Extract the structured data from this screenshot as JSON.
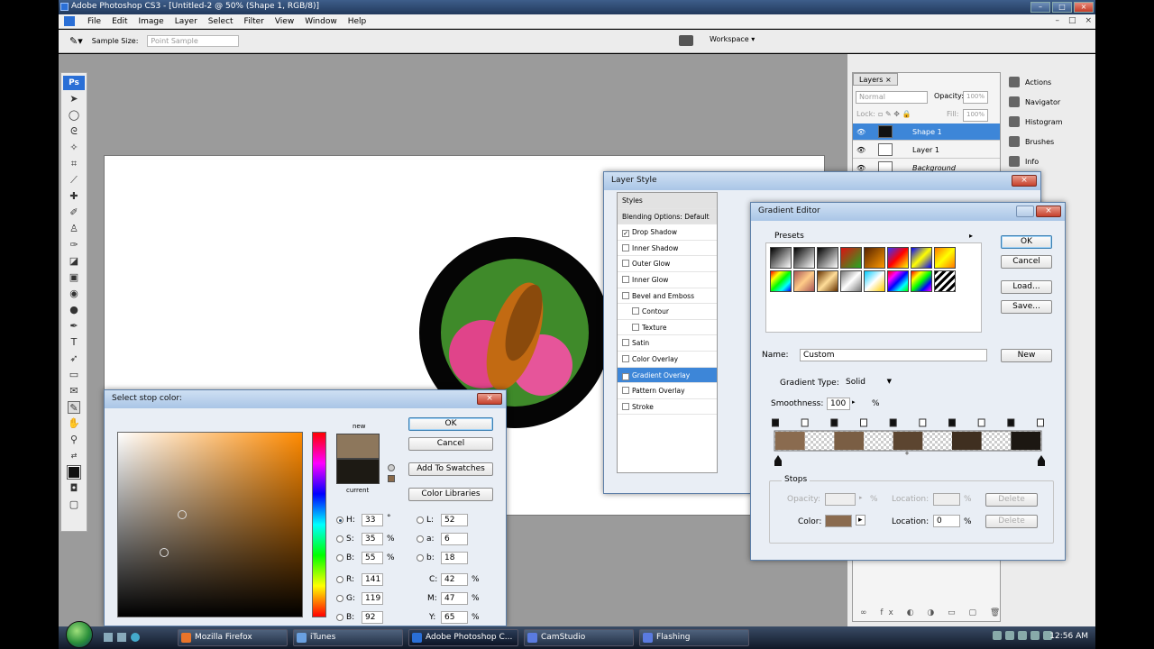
{
  "app": {
    "title": "Adobe Photoshop CS3 - [Untitled-2 @ 50% (Shape 1, RGB/8)]",
    "menu": [
      "File",
      "Edit",
      "Image",
      "Layer",
      "Select",
      "Filter",
      "View",
      "Window",
      "Help"
    ],
    "options": {
      "sample_size_label": "Sample Size:",
      "sample_size_value": "Point Sample",
      "workspace": "Workspace ▾"
    },
    "toolbox_logo": "Ps"
  },
  "layers_panel": {
    "tab": "Layers ×",
    "blend_mode": "Normal",
    "opacity_label": "Opacity:",
    "opacity": "100%",
    "lock_label": "Lock:",
    "fill_label": "Fill:",
    "fill": "100%",
    "layers": [
      {
        "name": "Shape 1",
        "selected": true
      },
      {
        "name": "Layer 1",
        "selected": false
      },
      {
        "name": "Background",
        "selected": false
      }
    ]
  },
  "side_panels": [
    "Actions",
    "Navigator",
    "Histogram",
    "Brushes",
    "Info"
  ],
  "layer_style": {
    "title": "Layer Style",
    "items": [
      {
        "label": "Styles",
        "type": "header"
      },
      {
        "label": "Blending Options: Default",
        "type": "header"
      },
      {
        "label": "Drop Shadow",
        "checked": true
      },
      {
        "label": "Inner Shadow",
        "checked": false
      },
      {
        "label": "Outer Glow",
        "checked": false
      },
      {
        "label": "Inner Glow",
        "checked": false
      },
      {
        "label": "Bevel and Emboss",
        "checked": false
      },
      {
        "label": "Contour",
        "checked": false,
        "indent": true
      },
      {
        "label": "Texture",
        "checked": false,
        "indent": true
      },
      {
        "label": "Satin",
        "checked": false
      },
      {
        "label": "Color Overlay",
        "checked": false
      },
      {
        "label": "Gradient Overlay",
        "checked": true,
        "selected": true
      },
      {
        "label": "Pattern Overlay",
        "checked": false
      },
      {
        "label": "Stroke",
        "checked": false
      }
    ]
  },
  "gradient_editor": {
    "title": "Gradient Editor",
    "presets_label": "Presets",
    "buttons": {
      "ok": "OK",
      "cancel": "Cancel",
      "load": "Load...",
      "save": "Save...",
      "new": "New"
    },
    "name_label": "Name:",
    "name_value": "Custom",
    "type_label": "Gradient Type:",
    "type_value": "Solid",
    "smoothness_label": "Smoothness:",
    "smoothness_value": "100",
    "percent": "%",
    "stops_label": "Stops",
    "opacity_label": "Opacity:",
    "location_label": "Location:",
    "delete": "Delete",
    "color_label": "Color:",
    "color_location_value": "0",
    "stop_color": "#8a6b4f",
    "gradient_stops": [
      "#8a6b4f",
      "#7a5e44",
      "#5c4530",
      "#3f2f20",
      "#1c1712"
    ]
  },
  "color_picker": {
    "title": "Select stop color:",
    "new_label": "new",
    "current_label": "current",
    "new_color": "#8d775c",
    "current_color": "#1d1a14",
    "buttons": {
      "ok": "OK",
      "cancel": "Cancel",
      "add_swatches": "Add To Swatches",
      "libraries": "Color Libraries"
    },
    "fields": {
      "H": "33",
      "S": "35",
      "B": "55",
      "R": "141",
      "G": "119",
      "Bl": "92",
      "L": "52",
      "a": "6",
      "b": "18",
      "C": "42",
      "M": "47",
      "Y": "65"
    },
    "units": {
      "deg": "°",
      "pct": "%"
    }
  },
  "taskbar": {
    "tasks": [
      {
        "label": "Mozilla Firefox",
        "color": "#e8742a"
      },
      {
        "label": "iTunes",
        "color": "#6aa0e0"
      },
      {
        "label": "Adobe Photoshop C...",
        "color": "#2a6fd6",
        "active": true
      },
      {
        "label": "CamStudio",
        "color": "#5a7be0"
      },
      {
        "label": "Flashing",
        "color": "#5a7be0"
      }
    ],
    "clock": "12:56 AM"
  }
}
